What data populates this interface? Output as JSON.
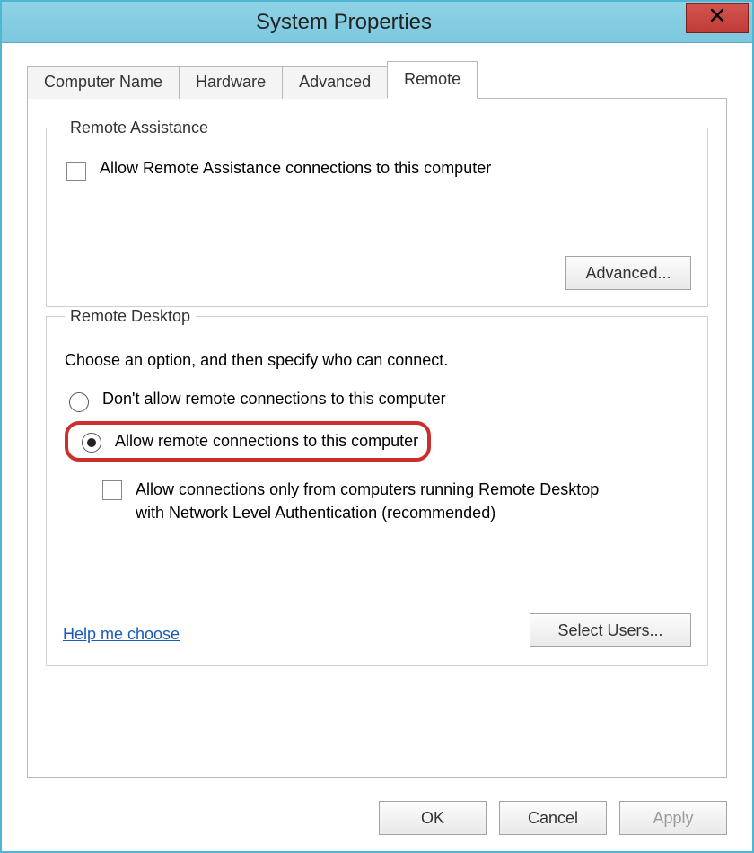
{
  "window": {
    "title": "System Properties"
  },
  "tabs": {
    "computer_name": "Computer Name",
    "hardware": "Hardware",
    "advanced": "Advanced",
    "remote": "Remote"
  },
  "remote_assistance": {
    "legend": "Remote Assistance",
    "allow_label": "Allow Remote Assistance connections to this computer",
    "allow_checked": false,
    "advanced_button": "Advanced..."
  },
  "remote_desktop": {
    "legend": "Remote Desktop",
    "instruction": "Choose an option, and then specify who can connect.",
    "option_disallow": "Don't allow remote connections to this computer",
    "option_allow": "Allow remote connections to this computer",
    "selected": "allow",
    "nla_label": "Allow connections only from computers running Remote Desktop with Network Level Authentication (recommended)",
    "nla_checked": false,
    "help_link": "Help me choose",
    "select_users_button": "Select Users..."
  },
  "buttons": {
    "ok": "OK",
    "cancel": "Cancel",
    "apply": "Apply"
  }
}
